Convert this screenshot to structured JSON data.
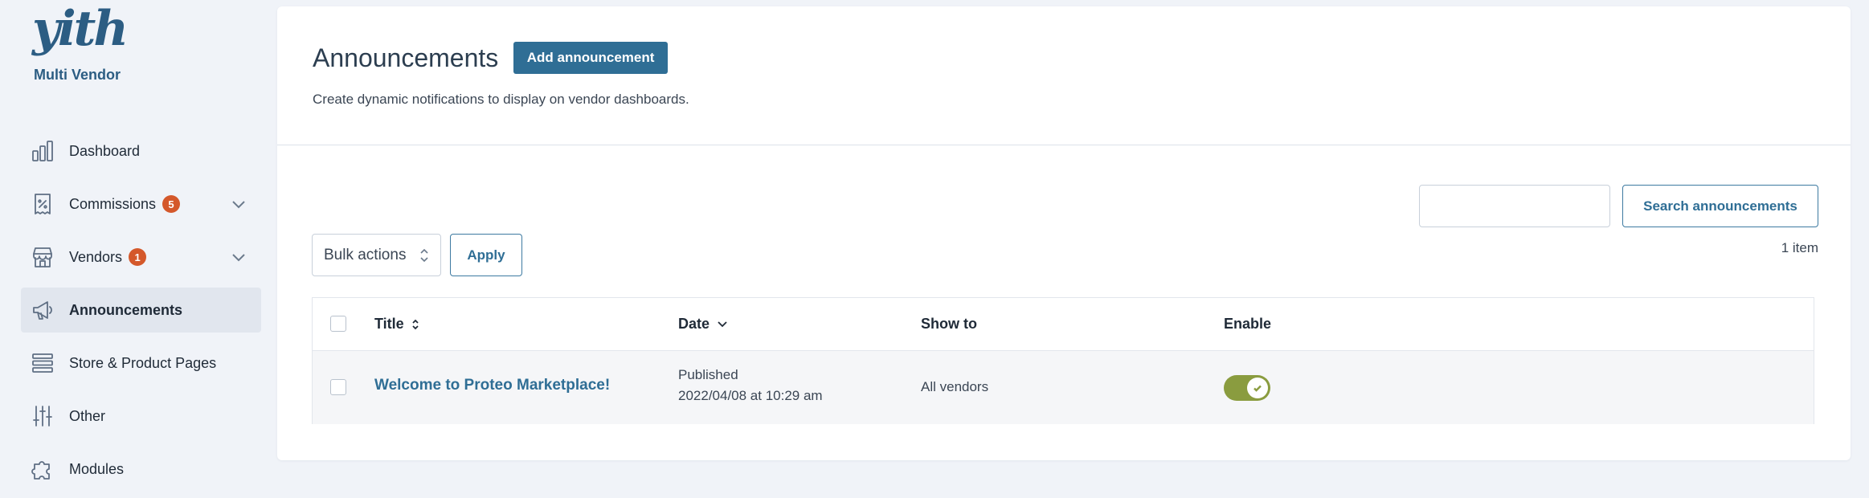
{
  "brand": {
    "logo_text": "yith",
    "subtitle": "Multi Vendor"
  },
  "sidebar": {
    "items": [
      {
        "label": "Dashboard",
        "icon": "bar-chart-icon"
      },
      {
        "label": "Commissions",
        "icon": "receipt-percent-icon",
        "badge": "5",
        "expandable": true
      },
      {
        "label": "Vendors",
        "icon": "store-icon",
        "badge": "1",
        "expandable": true
      },
      {
        "label": "Announcements",
        "icon": "megaphone-icon",
        "active": true
      },
      {
        "label": "Store & Product Pages",
        "icon": "layers-icon"
      },
      {
        "label": "Other",
        "icon": "sliders-icon"
      },
      {
        "label": "Modules",
        "icon": "puzzle-icon"
      }
    ]
  },
  "main": {
    "title": "Announcements",
    "add_button": "Add announcement",
    "description": "Create dynamic notifications to display on vendor dashboards.",
    "search": {
      "placeholder": "",
      "button": "Search announcements"
    },
    "item_count": "1 item",
    "bulk": {
      "selected": "Bulk actions",
      "apply": "Apply"
    },
    "table": {
      "columns": [
        "Title",
        "Date",
        "Show to",
        "Enable"
      ],
      "rows": [
        {
          "title": "Welcome to Proteo Marketplace!",
          "status": "Published",
          "date": "2022/04/08 at 10:29 am",
          "show_to": "All vendors",
          "enabled": true
        }
      ]
    }
  },
  "colors": {
    "accent": "#2f6e95",
    "badge": "#d4582b",
    "toggle_on": "#8a9c3f",
    "background": "#f0f3f8"
  }
}
